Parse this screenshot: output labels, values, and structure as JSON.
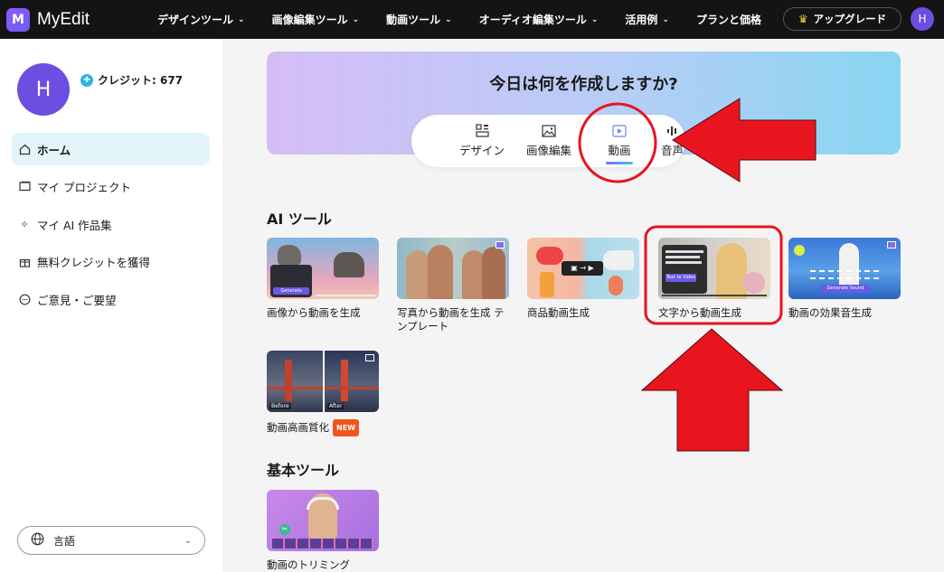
{
  "header": {
    "logo_text": "MyEdit",
    "nav": [
      {
        "label": "デザインツール"
      },
      {
        "label": "画像編集ツール"
      },
      {
        "label": "動画ツール"
      },
      {
        "label": "オーディオ編集ツール"
      },
      {
        "label": "活用例"
      },
      {
        "label": "プランと価格"
      }
    ],
    "upgrade_label": "アップグレード",
    "avatar_initial": "H"
  },
  "sidebar": {
    "avatar_initial": "H",
    "credit_label": "クレジット: 677",
    "items": [
      {
        "label": "ホーム",
        "icon": "home-icon"
      },
      {
        "label": "マイ プロジェクト",
        "icon": "folder-icon"
      },
      {
        "label": "マイ AI 作品集",
        "icon": "sparkle-icon"
      },
      {
        "label": "無料クレジットを獲得",
        "icon": "gift-icon"
      },
      {
        "label": "ご意見・ご要望",
        "icon": "chat-icon"
      }
    ],
    "language_label": "言語"
  },
  "hero": {
    "title": "今日は何を作成しますか?",
    "tabs": [
      {
        "label": "デザイン",
        "icon": "design-icon"
      },
      {
        "label": "画像編集",
        "icon": "image-icon"
      },
      {
        "label": "動画",
        "icon": "video-icon"
      },
      {
        "label": "音声",
        "icon": "audio-icon"
      }
    ]
  },
  "ai_tools": {
    "title": "AI ツール",
    "cards": [
      {
        "label": "画像から動画を生成",
        "overlay": "Generate"
      },
      {
        "label": "写真から動画を生成 テンプレート"
      },
      {
        "label": "商品動画生成"
      },
      {
        "label": "文字から動画生成",
        "overlay": "Text to Video"
      },
      {
        "label": "動画の効果音生成",
        "overlay": "Generate Sound"
      },
      {
        "label": "動画高画質化",
        "badge": "NEW",
        "before": "Before",
        "after": "After"
      }
    ]
  },
  "basic_tools": {
    "title": "基本ツール",
    "cards": [
      {
        "label": "動画のトリミング"
      }
    ]
  },
  "colors": {
    "accent": "#6c4fe0",
    "annotation_red": "#e8141e",
    "nav_bg": "#141414"
  }
}
